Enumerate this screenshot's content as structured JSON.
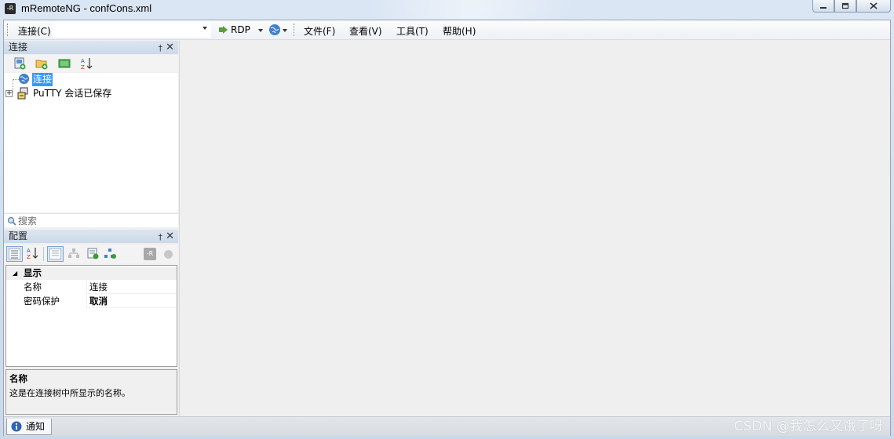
{
  "window": {
    "title": "mRemoteNG - confCons.xml",
    "icon_text": "-R",
    "controls": [
      "minimize-icon",
      "maximize-icon",
      "close-icon"
    ]
  },
  "menubar": {
    "connections_label": "连接(C)",
    "quick_connect_value": "",
    "protocol_label": "RDP",
    "file_label": "文件(F)",
    "view_label": "查看(V)",
    "tools_label": "工具(T)",
    "help_label": "帮助(H)"
  },
  "connections_panel": {
    "title": "连接",
    "toolbar_icons": [
      "new-connection-icon",
      "new-folder-icon",
      "view-icon",
      "sort-az-icon"
    ],
    "tree": [
      {
        "label": "连接",
        "icon": "globe-icon",
        "selected": true
      },
      {
        "label": "PuTTY 会话已保存",
        "icon": "putty-icon",
        "selected": false
      }
    ],
    "search_placeholder": "搜索"
  },
  "config_panel": {
    "title": "配置",
    "category": "显示",
    "rows": [
      {
        "name": "名称",
        "value": "连接"
      },
      {
        "name": "密码保护",
        "value": "取消"
      }
    ],
    "help_title": "名称",
    "help_desc": "这是在连接树中所显示的名称。"
  },
  "status": {
    "notifications_label": "通知"
  },
  "watermark": "CSDN @我怎么又饿了呀",
  "colors": {
    "selection": "#3399ff",
    "panel_header": "#cbd8e8",
    "background": "#efefef"
  }
}
